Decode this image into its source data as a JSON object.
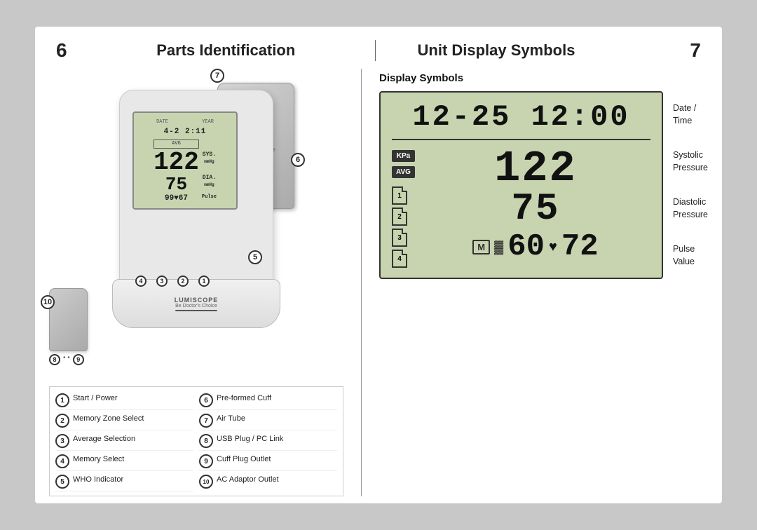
{
  "header": {
    "page_left": "6",
    "page_right": "7",
    "title_left": "Parts Identification",
    "title_right": "Unit Display Symbols"
  },
  "display_symbols": {
    "section_title": "Display Symbols",
    "lcd": {
      "date_time": "12-25  12:00",
      "kpa_label": "KPa",
      "avg_label": "AVG",
      "systolic": "122",
      "diastolic": "75",
      "m_badge": "M",
      "battery_icon": "🔋",
      "heart_icon": "♥",
      "pulse": "60",
      "pulse2": "72",
      "pages": [
        "1",
        "2",
        "3",
        "4"
      ]
    },
    "labels": {
      "date_time": "Date /\nTime",
      "systolic": "Systolic\nPressure",
      "diastolic": "Diastolic\nPressure",
      "pulse": "Pulse\nValue"
    }
  },
  "parts": {
    "items": [
      {
        "num": "1",
        "label": "Start / Power",
        "col": 1
      },
      {
        "num": "6",
        "label": "Pre-formed Cuff",
        "col": 2
      },
      {
        "num": "2",
        "label": "Memory Zone Select",
        "col": 1
      },
      {
        "num": "7",
        "label": "Air Tube",
        "col": 2
      },
      {
        "num": "3",
        "label": "Average Selection",
        "col": 1
      },
      {
        "num": "8",
        "label": "USB Plug / PC Link",
        "col": 2
      },
      {
        "num": "4",
        "label": "Memory Select",
        "col": 1
      },
      {
        "num": "9",
        "label": "Cuff Plug Outlet",
        "col": 2
      },
      {
        "num": "5",
        "label": "WHO Indicator",
        "col": 1
      },
      {
        "num": "10",
        "label": "AC Adaptor Outlet",
        "col": 2
      }
    ]
  },
  "callouts": {
    "device": [
      "1",
      "2",
      "3",
      "4",
      "5",
      "6",
      "7"
    ],
    "small_device": [
      "8",
      "9",
      "10"
    ]
  }
}
